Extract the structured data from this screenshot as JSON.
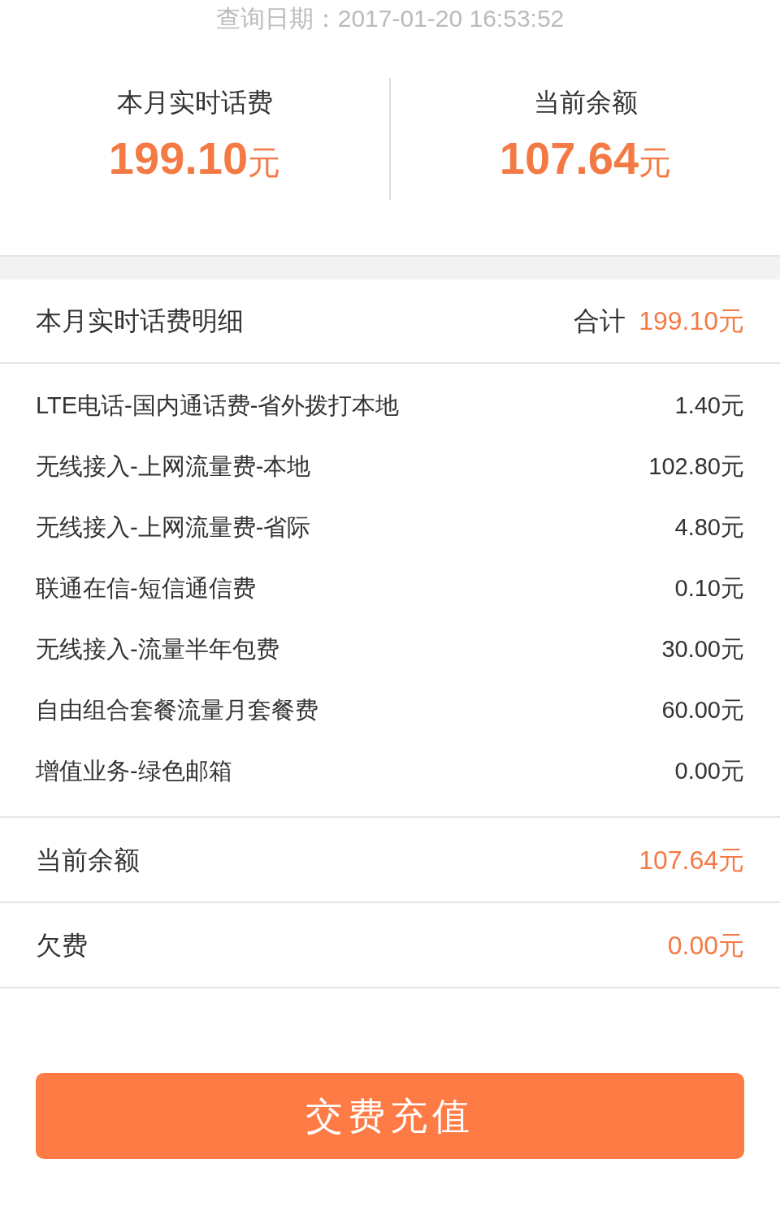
{
  "query_date": "查询日期：2017-01-20 16:53:52",
  "summary": [
    {
      "label": "本月实时话费",
      "amount": "199.10",
      "unit": "元"
    },
    {
      "label": "当前余额",
      "amount": "107.64",
      "unit": "元"
    }
  ],
  "detail": {
    "title": "本月实时话费明细",
    "total_label": "合计",
    "total": "199.10元",
    "items": [
      {
        "name": "LTE电话-国内通话费-省外拨打本地",
        "amount": "1.40元"
      },
      {
        "name": "无线接入-上网流量费-本地",
        "amount": "102.80元"
      },
      {
        "name": "无线接入-上网流量费-省际",
        "amount": "4.80元"
      },
      {
        "name": "联通在信-短信通信费",
        "amount": "0.10元"
      },
      {
        "name": "无线接入-流量半年包费",
        "amount": "30.00元"
      },
      {
        "name": "自由组合套餐流量月套餐费",
        "amount": "60.00元"
      },
      {
        "name": "增值业务-绿色邮箱",
        "amount": "0.00元"
      }
    ]
  },
  "rows": [
    {
      "label": "当前余额",
      "value": "107.64元"
    },
    {
      "label": "欠费",
      "value": "0.00元"
    }
  ],
  "button": "交费充值"
}
